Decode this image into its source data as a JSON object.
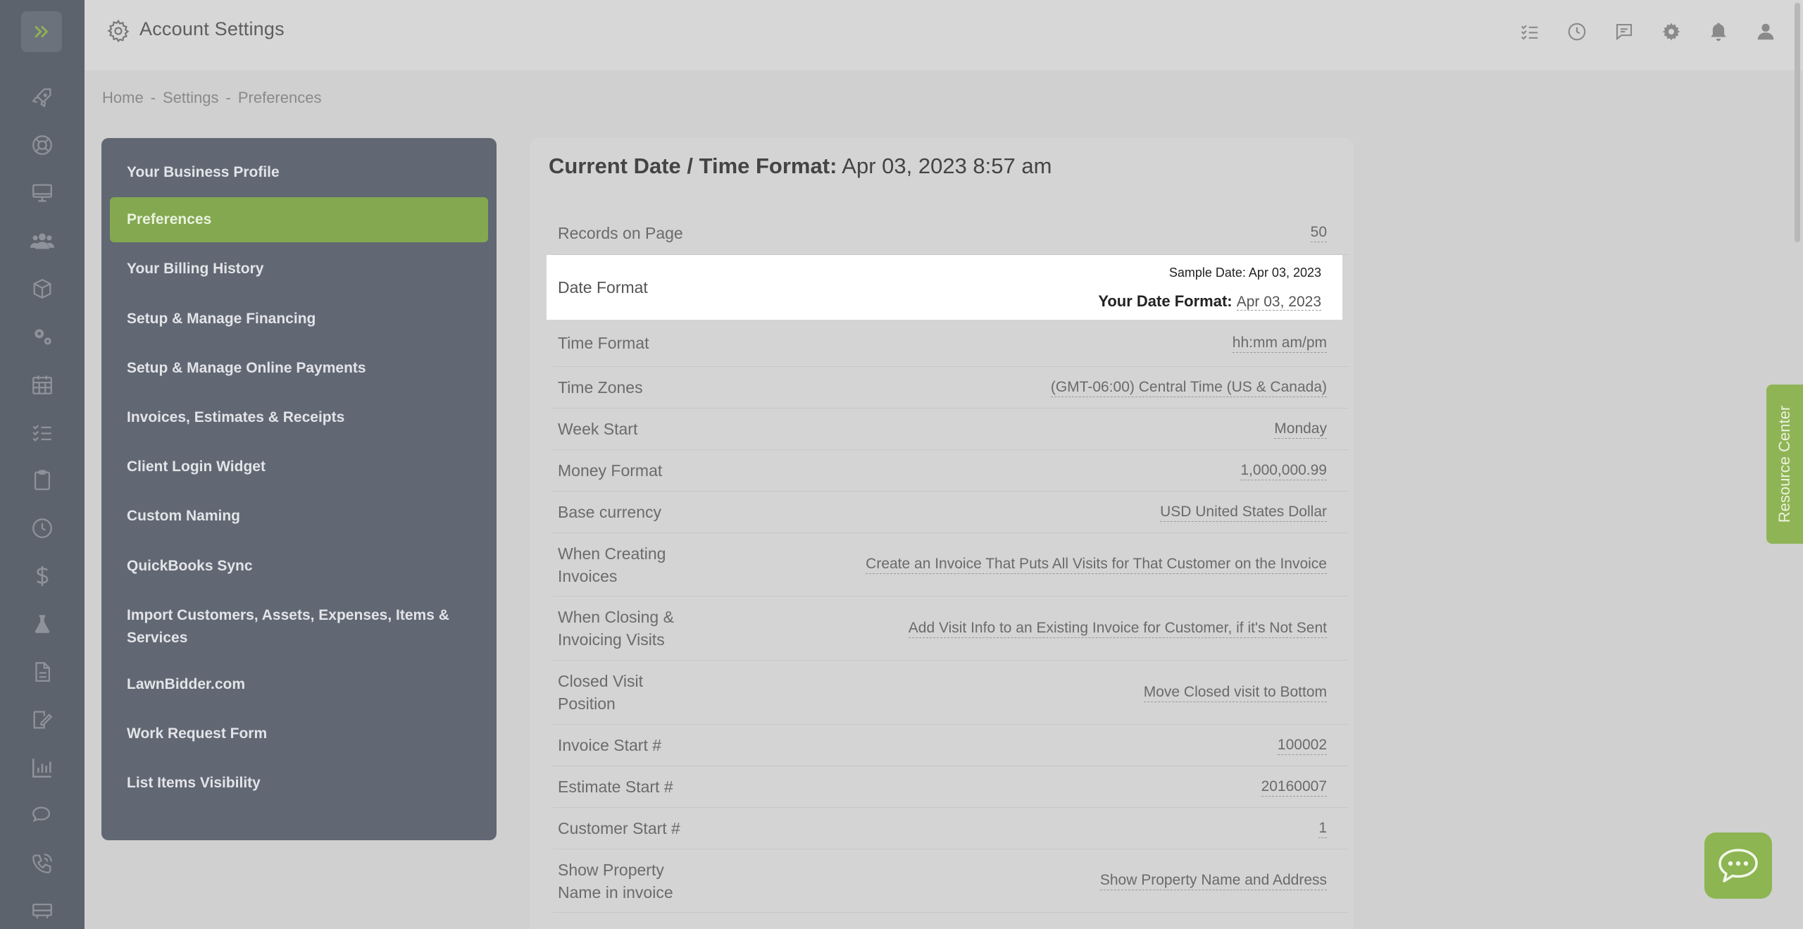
{
  "app": {
    "title": "Account Settings"
  },
  "breadcrumb": {
    "home": "Home",
    "settings": "Settings",
    "current": "Preferences",
    "sep": "-"
  },
  "nav": {
    "items": [
      {
        "label": "Your Business Profile"
      },
      {
        "label": "Preferences",
        "active": true
      },
      {
        "label": "Your Billing History"
      },
      {
        "label": "Setup & Manage Financing"
      },
      {
        "label": "Setup & Manage Online Payments"
      },
      {
        "label": "Invoices, Estimates & Receipts"
      },
      {
        "label": "Client Login Widget"
      },
      {
        "label": "Custom Naming"
      },
      {
        "label": "QuickBooks Sync"
      },
      {
        "label": "Import Customers, Assets, Expenses, Items & Services"
      },
      {
        "label": "LawnBidder.com"
      },
      {
        "label": "Work Request Form"
      },
      {
        "label": "List Items Visibility"
      }
    ]
  },
  "card": {
    "heading_label": "Current Date / Time Format:",
    "heading_value": "Apr 03, 2023 8:57 am",
    "rows": [
      {
        "label": "Records on Page",
        "value": "50"
      },
      {
        "label": "Date Format",
        "sample": "Sample Date: Apr 03, 2023",
        "your_label": "Your Date Format:",
        "value": "Apr 03, 2023"
      },
      {
        "label": "Time Format",
        "value": "hh:mm am/pm"
      },
      {
        "label": "Time Zones",
        "value": "(GMT-06:00) Central Time (US & Canada)"
      },
      {
        "label": "Week Start",
        "value": "Monday"
      },
      {
        "label": "Money Format",
        "value": "1,000,000.99"
      },
      {
        "label": "Base currency",
        "value": "USD United States Dollar"
      },
      {
        "label": "When Creating Invoices",
        "value": "Create an Invoice That Puts All Visits for That Customer on the Invoice"
      },
      {
        "label": "When Closing & Invoicing Visits",
        "value": "Add Visit Info to an Existing Invoice for Customer, if it's Not Sent"
      },
      {
        "label": "Closed Visit Position",
        "value": "Move Closed visit to Bottom"
      },
      {
        "label": "Invoice Start #",
        "value": "100002"
      },
      {
        "label": "Estimate Start #",
        "value": "20160007"
      },
      {
        "label": "Customer Start #",
        "value": "1"
      },
      {
        "label": "Show Property Name in invoice",
        "value": "Show Property Name and Address"
      }
    ]
  },
  "resource_center": {
    "label": "Resource Center"
  },
  "icons": {
    "rail": [
      "expand-icon",
      "rocket-icon",
      "lifebuoy-icon",
      "monitor-icon",
      "users-icon",
      "box-icon",
      "cogs-icon",
      "calendar-icon",
      "tasks-icon",
      "clipboard-icon",
      "clock-icon",
      "dollar-icon",
      "flask-icon",
      "document-icon",
      "signature-icon",
      "chart-icon",
      "chat-icon",
      "phone-icon",
      "truck-icon"
    ],
    "top": [
      "tasks-icon",
      "history-icon",
      "message-icon",
      "settings-icon",
      "bell-icon",
      "user-icon"
    ]
  },
  "colors": {
    "rail": "#5d636c",
    "nav_panel": "#616773",
    "accent": "#83a850",
    "background": "#d0d0d0"
  }
}
